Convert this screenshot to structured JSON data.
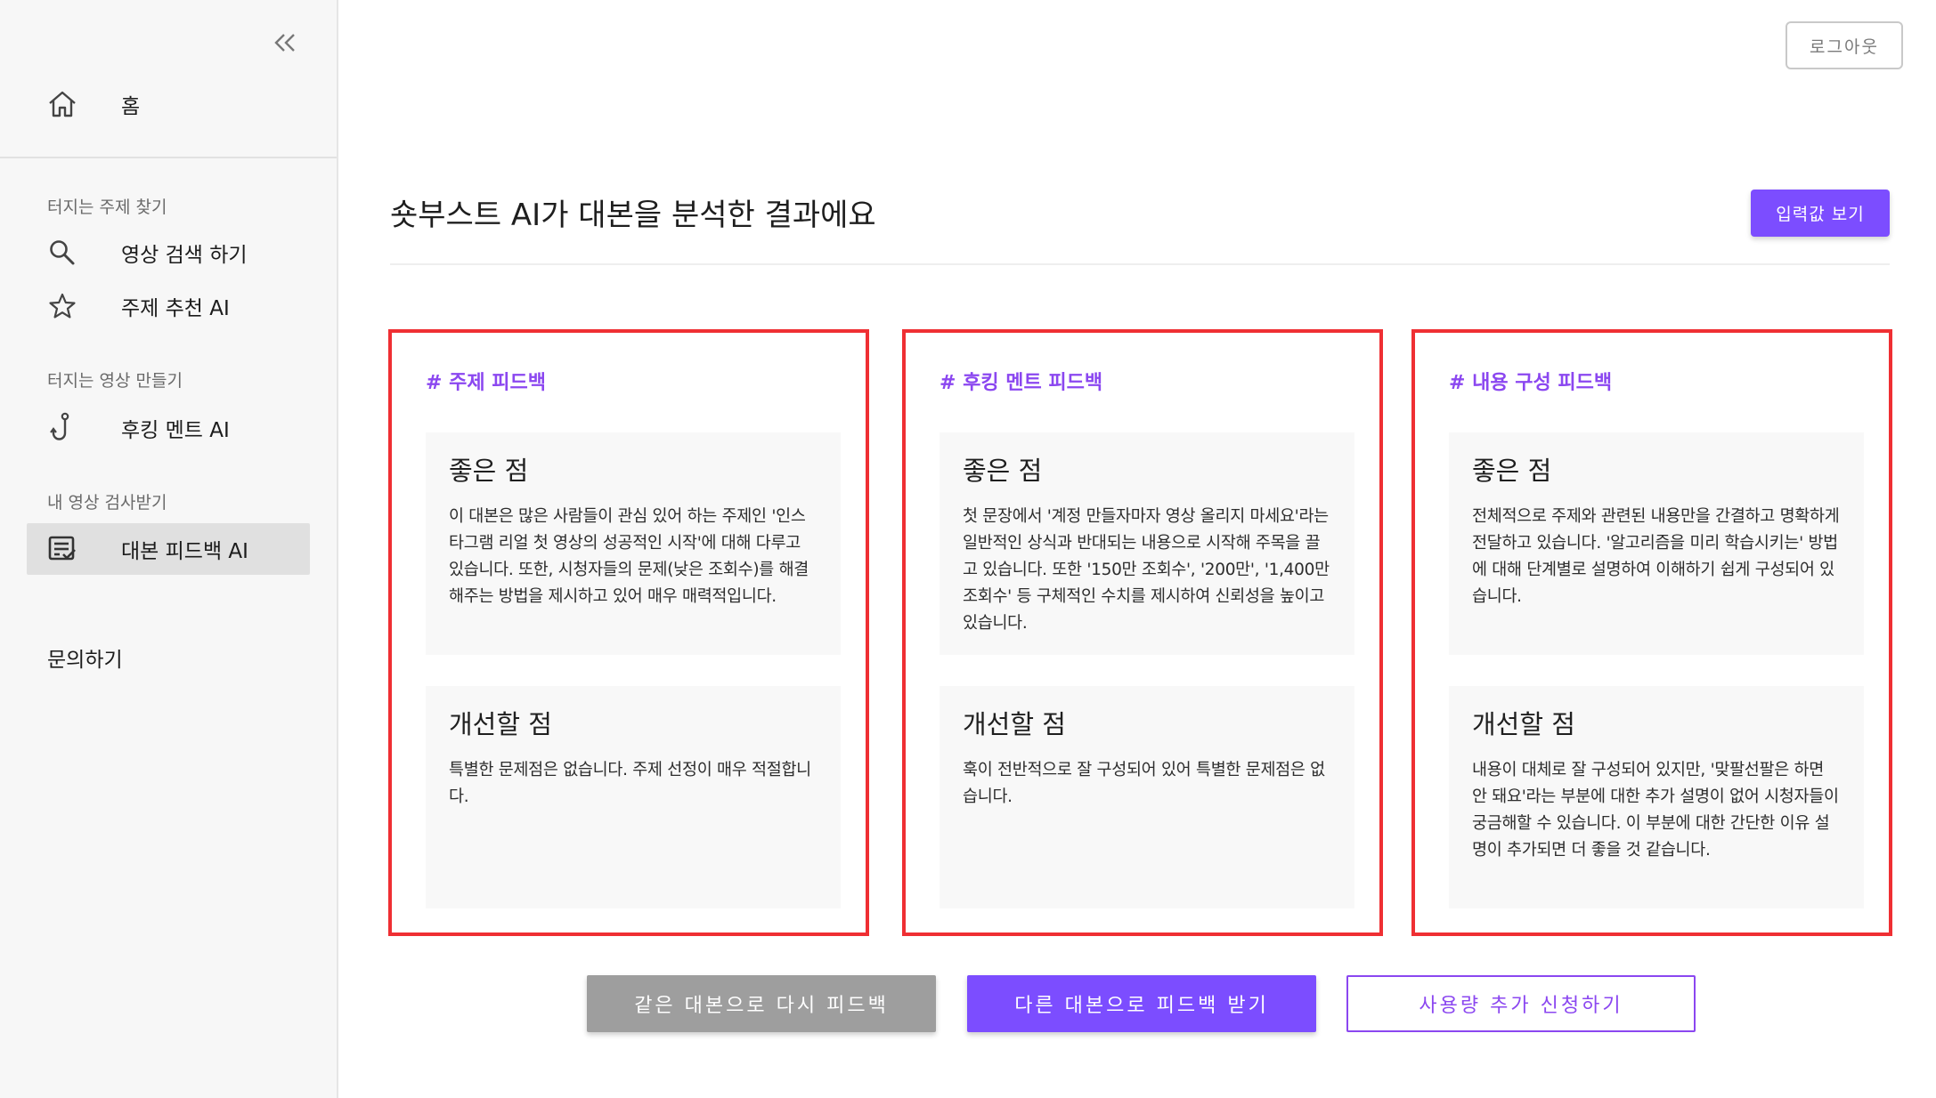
{
  "sidebar": {
    "home_label": "홈",
    "sections": [
      {
        "title": "터지는 주제 찾기",
        "items": [
          {
            "label": "영상 검색 하기",
            "icon": "search-icon"
          },
          {
            "label": "주제 추천 AI",
            "icon": "star-icon"
          }
        ]
      },
      {
        "title": "터지는 영상 만들기",
        "items": [
          {
            "label": "후킹 멘트 AI",
            "icon": "hook-icon"
          }
        ]
      },
      {
        "title": "내 영상 검사받기",
        "items": [
          {
            "label": "대본 피드백 AI",
            "icon": "script-check-icon",
            "active": true
          }
        ]
      }
    ],
    "contact_label": "문의하기"
  },
  "header": {
    "logout_label": "로그아웃",
    "title": "숏부스트 AI가 대본을 분석한 결과에요",
    "view_input_label": "입력값 보기"
  },
  "cards": [
    {
      "title": "# 주제 피드백",
      "good_title": "좋은 점",
      "good_text": "이 대본은 많은 사람들이 관심 있어 하는 주제인 '인스타그램 리얼 첫 영상의 성공적인 시작'에 대해 다루고 있습니다. 또한, 시청자들의 문제(낮은 조회수)를 해결해주는 방법을 제시하고 있어 매우 매력적입니다.",
      "improve_title": "개선할 점",
      "improve_text": "특별한 문제점은 없습니다. 주제 선정이 매우 적절합니다."
    },
    {
      "title": "# 후킹 멘트 피드백",
      "good_title": "좋은 점",
      "good_text": "첫 문장에서 '계정 만들자마자 영상 올리지 마세요'라는 일반적인 상식과 반대되는 내용으로 시작해 주목을 끌고 있습니다. 또한 '150만 조회수', '200만', '1,400만 조회수' 등 구체적인 수치를 제시하여 신뢰성을 높이고 있습니다.",
      "improve_title": "개선할 점",
      "improve_text": "훅이 전반적으로 잘 구성되어 있어 특별한 문제점은 없습니다."
    },
    {
      "title": "# 내용 구성 피드백",
      "good_title": "좋은 점",
      "good_text": "전체적으로 주제와 관련된 내용만을 간결하고 명확하게 전달하고 있습니다. '알고리즘을 미리 학습시키는' 방법에 대해 단계별로 설명하여 이해하기 쉽게 구성되어 있습니다.",
      "improve_title": "개선할 점",
      "improve_text": "내용이 대체로 잘 구성되어 있지만, '맞팔선팔은 하면 안 돼요'라는 부분에 대한 추가 설명이 없어 시청자들이 궁금해할 수 있습니다. 이 부분에 대한 간단한 이유 설명이 추가되면 더 좋을 것 같습니다."
    }
  ],
  "actions": {
    "same_script_label": "같은 대본으로 다시 피드백",
    "other_script_label": "다른 대본으로 피드백 받기",
    "more_usage_label": "사용량 추가 신청하기"
  },
  "colors": {
    "accent": "#7c4dff",
    "card_title": "#8b47f0",
    "card_border": "#ef2f33",
    "secondary_button": "#9e9e9e"
  }
}
